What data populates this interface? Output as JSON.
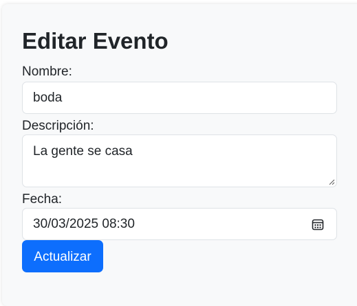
{
  "form": {
    "title": "Editar Evento",
    "nombre_label": "Nombre:",
    "nombre_value": "boda",
    "descripcion_label": "Descripción:",
    "descripcion_value": "La gente se casa",
    "fecha_label": "Fecha:",
    "fecha_value": "30/03/2025 08:30",
    "submit_label": "Actualizar"
  },
  "icons": {
    "calendar": "calendar-icon",
    "resize": "resize-grip-icon"
  },
  "colors": {
    "card_background": "#f8f9fa",
    "primary_button": "#0d6efd",
    "field_border": "#dee2e6",
    "text": "#212529"
  }
}
